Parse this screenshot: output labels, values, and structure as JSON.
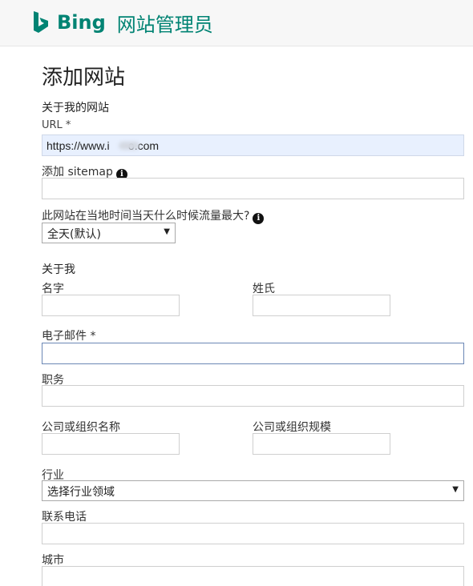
{
  "header": {
    "brand": "Bing",
    "product": "网站管理员",
    "brand_color": "#008373"
  },
  "page": {
    "title": "添加网站"
  },
  "site": {
    "section_title": "关于我的网站",
    "url_label": "URL *",
    "url_value": "https://www.i      o.com",
    "sitemap_label": "添加 sitemap",
    "sitemap_value": "",
    "traffic_label": "此网站在当地时间当天什么时候流量最大?",
    "traffic_selected": "全天(默认)"
  },
  "about": {
    "section_title": "关于我",
    "first_name_label": "名字",
    "last_name_label": "姓氏",
    "email_label": "电子邮件 *",
    "job_label": "职务",
    "company_label": "公司或组织名称",
    "company_size_label": "公司或组织规模",
    "industry_label": "行业",
    "industry_selected": "选择行业领域",
    "phone_label": "联系电话",
    "city_label": "城市"
  },
  "icons": {
    "info": "info-icon",
    "caret": "chevron-down-icon"
  }
}
